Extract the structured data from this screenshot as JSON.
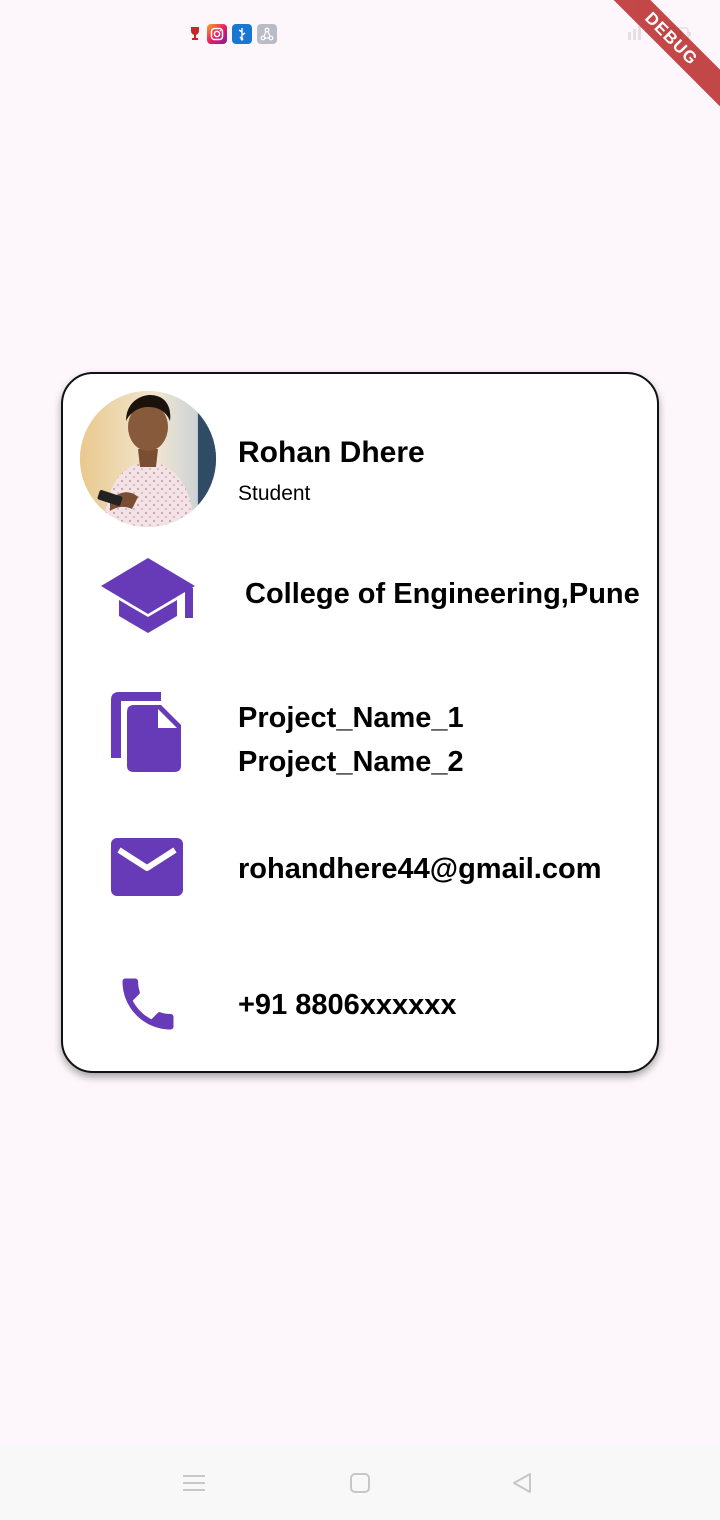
{
  "status_bar": {
    "icons": [
      "trophy-icon",
      "instagram-icon",
      "usb-icon",
      "share-icon"
    ]
  },
  "debug_banner": "DEBUG",
  "profile": {
    "name": "Rohan Dhere",
    "role": "Student",
    "avatar_alt": "profile photo"
  },
  "details": {
    "college": "College of Engineering,Pune",
    "projects": [
      "Project_Name_1",
      "Project_Name_2"
    ],
    "email": "rohandhere44@gmail.com",
    "phone": "+91 8806xxxxxx"
  },
  "colors": {
    "accent": "#673ab7",
    "background": "#fdf7fb",
    "card": "#ffffff",
    "debug_ribbon": "#b71c1c"
  },
  "nav_bar": {
    "buttons": [
      "menu-icon",
      "home-icon",
      "back-icon"
    ]
  }
}
